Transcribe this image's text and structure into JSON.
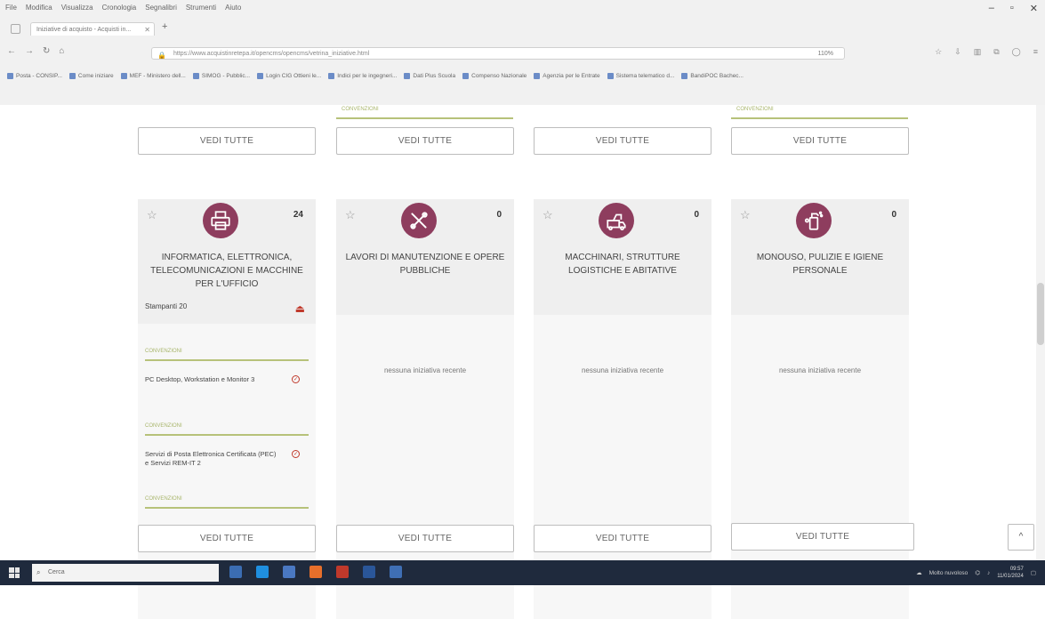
{
  "browser": {
    "menu": [
      "File",
      "Modifica",
      "Visualizza",
      "Cronologia",
      "Segnalibri",
      "Strumenti",
      "Aiuto"
    ],
    "tab_title": "Iniziative di acquisto - Acquisti in...",
    "url": "https://www.acquistinretepa.it/opencms/opencms/vetrina_iniziative.html",
    "zoom": "110%",
    "bookmarks": [
      "Posta - CONSIP...",
      "Come iniziare",
      "MEF - Ministero dell...",
      "SIMOG - Pubblic...",
      "Login CIG Ottieni le...",
      "Indici per le ingegneri...",
      "Dati Plus Scuola",
      "Compenso Nazionale",
      "Agenzia per le Entrate",
      "Sistema telematico d...",
      "BandiPOC Bachec..."
    ]
  },
  "page": {
    "vedi_label": "VEDI TUTTE",
    "convenzioni_label": "CONVENZIONI",
    "no_initiatives": "nessuna iniziativa recente",
    "back_to_top": "^",
    "categories": [
      {
        "title": "INFORMATICA, ELETTRONICA, TELECOMUNICAZIONI E MACCHINE PER L'UFFICIO",
        "count": "24",
        "subcount": "Stampanti 20",
        "icon": "printer-icon",
        "items": [
          {
            "text": "PC Desktop, Workstation e Monitor 3"
          },
          {
            "text": "Servizi di Posta Elettronica Certificata (PEC) e Servizi REM-IT 2"
          }
        ]
      },
      {
        "title": "LAVORI DI MANUTENZIONE E OPERE PUBBLICHE",
        "count": "0",
        "icon": "tools-icon"
      },
      {
        "title": "MACCHINARI, STRUTTURE LOGISTICHE E ABITATIVE",
        "count": "0",
        "icon": "machinery-icon"
      },
      {
        "title": "MONOUSO, PULIZIE E IGIENE PERSONALE",
        "count": "0",
        "icon": "cleaning-spray-icon"
      }
    ]
  },
  "taskbar": {
    "search_placeholder": "Cerca",
    "tray_text": "Molto nuvoloso",
    "clock_time": "09:57",
    "clock_date": "11/01/2024"
  },
  "colors": {
    "accent": "#8e3d5e",
    "divider": "#b7c27a"
  }
}
